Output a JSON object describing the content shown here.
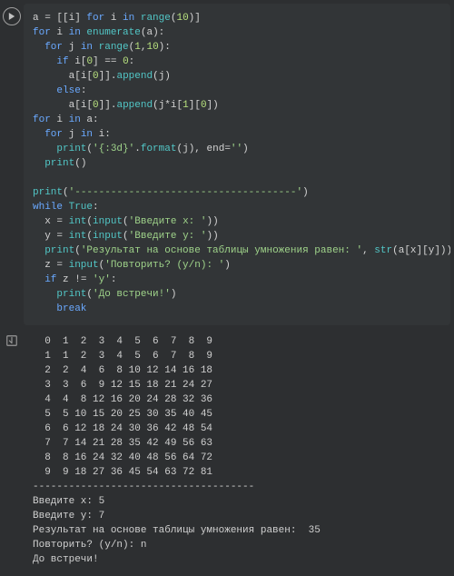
{
  "code": {
    "l1": {
      "a": "a ",
      "eq": "= ",
      "b1": "[[",
      "id1": "i",
      "b2": "] ",
      "kw1": "for ",
      "id2": "i ",
      "kw2": "in ",
      "fn": "range",
      "p1": "(",
      "n": "10",
      "p2": ")]"
    },
    "l2": {
      "kw1": "for ",
      "id1": "i ",
      "kw2": "in ",
      "fn": "enumerate",
      "p1": "(",
      "id2": "a",
      "p2": "):"
    },
    "l3": {
      "kw1": "for ",
      "id1": "j ",
      "kw2": "in ",
      "fn": "range",
      "p1": "(",
      "n1": "1",
      "c": ",",
      "n2": "10",
      "p2": "):"
    },
    "l4": {
      "kw": "if ",
      "id": "i",
      "br": "[",
      "n": "0",
      "br2": "] ",
      "op": "== ",
      "n2": "0",
      "col": ":"
    },
    "l5": {
      "id": "a",
      "b1": "[",
      "id2": "i",
      "b2": "[",
      "n": "0",
      "b3": "]].",
      "fn": "append",
      "p1": "(",
      "id3": "j",
      "p2": ")"
    },
    "l6": {
      "kw": "else",
      "col": ":"
    },
    "l7": {
      "id": "a",
      "b1": "[",
      "id2": "i",
      "b2": "[",
      "n": "0",
      "b3": "]].",
      "fn": "append",
      "p1": "(",
      "id3": "j",
      "op": "*",
      "id4": "i",
      "b4": "[",
      "n2": "1",
      "b5": "][",
      "n3": "0",
      "b6": "])"
    },
    "l8": {
      "kw1": "for ",
      "id1": "i ",
      "kw2": "in ",
      "id2": "a",
      "col": ":"
    },
    "l9": {
      "kw1": "for ",
      "id1": "j ",
      "kw2": "in ",
      "id2": "i",
      "col": ":"
    },
    "l10": {
      "fn": "print",
      "p1": "(",
      "s": "'{:3d}'",
      "dot": ".",
      "m": "format",
      "p2": "(",
      "id": "j",
      "p3": "), ",
      "kw": "end",
      "eq": "=",
      "s2": "''",
      "p4": ")"
    },
    "l11": {
      "fn": "print",
      "p": "()"
    },
    "l12": {
      "fn": "print",
      "p1": "(",
      "s": "'-------------------------------------'",
      "p2": ")"
    },
    "l13": {
      "kw": "while ",
      "tr": "True",
      "col": ":"
    },
    "l14": {
      "id": "x ",
      "eq": "= ",
      "fn": "int",
      "p1": "(",
      "fn2": "input",
      "p2": "(",
      "s": "'Введите x: '",
      "p3": "))"
    },
    "l15": {
      "id": "y ",
      "eq": "= ",
      "fn": "int",
      "p1": "(",
      "fn2": "input",
      "p2": "(",
      "s": "'Введите y: '",
      "p3": "))"
    },
    "l16": {
      "fn": "print",
      "p1": "(",
      "s": "'Результат на основе таблицы умножения равен: '",
      "c": ", ",
      "fn2": "str",
      "p2": "(",
      "id": "a",
      "b": "[x][y]))"
    },
    "l17": {
      "id": "z ",
      "eq": "= ",
      "fn": "input",
      "p1": "(",
      "s": "'Повторить? (y/n): '",
      "p2": ")"
    },
    "l18": {
      "kw": "if ",
      "id": "z ",
      "op": "!= ",
      "s": "'y'",
      "col": ":"
    },
    "l19": {
      "fn": "print",
      "p1": "(",
      "s": "'До встречи!'",
      "p2": ")"
    },
    "l20": {
      "kw": "break"
    }
  },
  "output_lines": [
    "  0  1  2  3  4  5  6  7  8  9",
    "  1  1  2  3  4  5  6  7  8  9",
    "  2  2  4  6  8 10 12 14 16 18",
    "  3  3  6  9 12 15 18 21 24 27",
    "  4  4  8 12 16 20 24 28 32 36",
    "  5  5 10 15 20 25 30 35 40 45",
    "  6  6 12 18 24 30 36 42 48 54",
    "  7  7 14 21 28 35 42 49 56 63",
    "  8  8 16 24 32 40 48 56 64 72",
    "  9  9 18 27 36 45 54 63 72 81",
    "-------------------------------------",
    "Введите x: 5",
    "Введите y: 7",
    "Результат на основе таблицы умножения равен:  35",
    "Повторить? (y/n): n",
    "До встречи!"
  ]
}
